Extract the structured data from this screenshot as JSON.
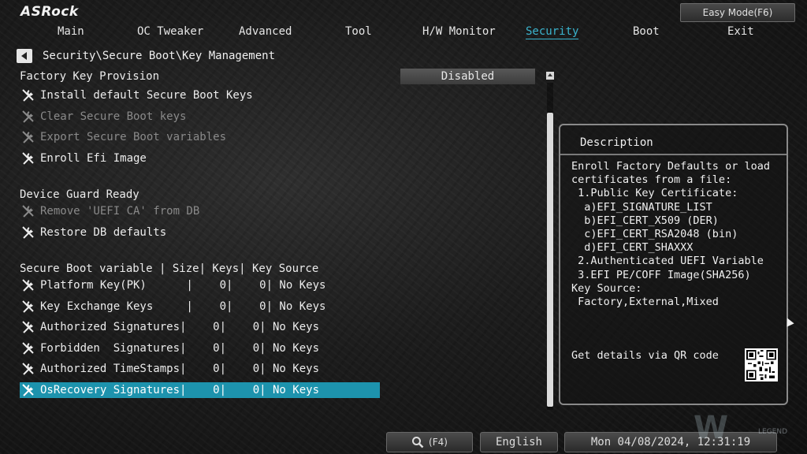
{
  "header": {
    "logo": "ASRock",
    "easy_mode_label": "Easy Mode(F6)"
  },
  "menu": [
    {
      "label": "Main"
    },
    {
      "label": "OC Tweaker"
    },
    {
      "label": "Advanced"
    },
    {
      "label": "Tool"
    },
    {
      "label": "H/W Monitor"
    },
    {
      "label": "Security",
      "active": true
    },
    {
      "label": "Boot"
    },
    {
      "label": "Exit"
    }
  ],
  "breadcrumb": "Security\\Secure Boot\\Key Management",
  "factory_key": {
    "label": "Factory Key Provision",
    "value": "Disabled"
  },
  "actions": [
    {
      "label": "Install default Secure Boot Keys",
      "enabled": true
    },
    {
      "label": "Clear Secure Boot keys",
      "enabled": false
    },
    {
      "label": "Export Secure Boot variables",
      "enabled": false
    },
    {
      "label": "Enroll Efi Image",
      "enabled": true
    }
  ],
  "device_guard": {
    "heading": "Device Guard Ready",
    "items": [
      {
        "label": "Remove 'UEFI CA' from DB",
        "enabled": false
      },
      {
        "label": "Restore DB defaults",
        "enabled": true
      }
    ]
  },
  "variables_header": "Secure Boot variable | Size| Keys| Key Source",
  "variables": [
    {
      "label": "Platform Key(PK)      |    0|    0| No Keys"
    },
    {
      "label": "Key Exchange Keys     |    0|    0| No Keys"
    },
    {
      "label": "Authorized Signatures|    0|    0| No Keys"
    },
    {
      "label": "Forbidden  Signatures|    0|    0| No Keys"
    },
    {
      "label": "Authorized TimeStamps|    0|    0| No Keys"
    },
    {
      "label": "OsRecovery Signatures|    0|    0| No Keys",
      "selected": true
    }
  ],
  "description": {
    "title": "Description",
    "body": "Enroll Factory Defaults or load\ncertificates from a file:\n 1.Public Key Certificate:\n  a)EFI_SIGNATURE_LIST\n  b)EFI_CERT_X509 (DER)\n  c)EFI_CERT_RSA2048 (bin)\n  d)EFI_CERT_SHAXXX\n 2.Authenticated UEFI Variable\n 3.EFI PE/COFF Image(SHA256)\nKey Source:\n Factory,External,Mixed",
    "qr_text": "Get details via QR code"
  },
  "footer": {
    "search_label": "(F4)",
    "language": "English",
    "datetime": "Mon 04/08/2024, 12:31:19"
  },
  "watermark": {
    "mark": "W",
    "text": "LEGEND"
  },
  "icons": {
    "tool": "wrench-screwdriver-icon",
    "search": "magnifier-icon",
    "back": "back-arrow-icon"
  },
  "colors": {
    "accent": "#3ab4ce",
    "selection": "#1d93ad",
    "disabled_text": "#8a8a8a"
  }
}
